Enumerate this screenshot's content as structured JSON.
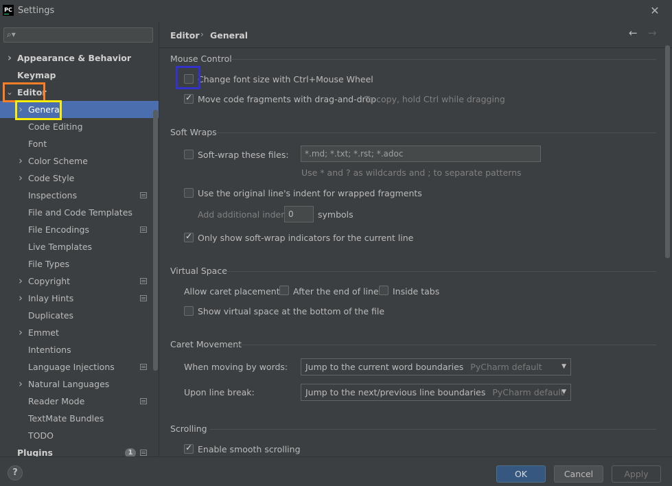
{
  "window": {
    "title": "Settings",
    "logo_text": "PC"
  },
  "search": {
    "placeholder": ""
  },
  "sidebar": {
    "items": [
      {
        "label": "Appearance & Behavior",
        "bold": true,
        "chevron": "right",
        "indent": 0
      },
      {
        "label": "Keymap",
        "bold": true,
        "chevron": "",
        "indent": 0
      },
      {
        "label": "Editor",
        "bold": true,
        "chevron": "down",
        "indent": 0
      },
      {
        "label": "General",
        "selected": true,
        "chevron": "right",
        "indent": 1
      },
      {
        "label": "Code Editing",
        "indent": 1
      },
      {
        "label": "Font",
        "indent": 1
      },
      {
        "label": "Color Scheme",
        "chevron": "right",
        "indent": 1
      },
      {
        "label": "Code Style",
        "chevron": "right",
        "indent": 1
      },
      {
        "label": "Inspections",
        "indent": 1,
        "badge": true
      },
      {
        "label": "File and Code Templates",
        "indent": 1
      },
      {
        "label": "File Encodings",
        "indent": 1,
        "badge": true
      },
      {
        "label": "Live Templates",
        "indent": 1
      },
      {
        "label": "File Types",
        "indent": 1
      },
      {
        "label": "Copyright",
        "chevron": "right",
        "indent": 1,
        "badge": true
      },
      {
        "label": "Inlay Hints",
        "chevron": "right",
        "indent": 1,
        "badge": true
      },
      {
        "label": "Duplicates",
        "indent": 1
      },
      {
        "label": "Emmet",
        "chevron": "right",
        "indent": 1
      },
      {
        "label": "Intentions",
        "indent": 1
      },
      {
        "label": "Language Injections",
        "indent": 1,
        "badge": true
      },
      {
        "label": "Natural Languages",
        "chevron": "right",
        "indent": 1
      },
      {
        "label": "Reader Mode",
        "indent": 1,
        "badge": true
      },
      {
        "label": "TextMate Bundles",
        "indent": 1
      },
      {
        "label": "TODO",
        "indent": 1
      },
      {
        "label": "Plugins",
        "bold": true,
        "indent": 0,
        "badge": true,
        "count": "1"
      }
    ]
  },
  "breadcrumb": {
    "parent": "Editor",
    "current": "General"
  },
  "mouse_control": {
    "title": "Mouse Control",
    "change_font": {
      "label": "Change font size with Ctrl+Mouse Wheel",
      "checked": false
    },
    "drag_drop": {
      "label": "Move code fragments with drag-and-drop",
      "checked": true,
      "hint": "To copy, hold Ctrl while dragging"
    }
  },
  "soft_wraps": {
    "title": "Soft Wraps",
    "softwrap_files": {
      "label": "Soft-wrap these files:",
      "checked": false,
      "value": "*.md; *.txt; *.rst; *.adoc",
      "hint": "Use * and ? as wildcards and ; to separate patterns"
    },
    "original_indent": {
      "label": "Use the original line's indent for wrapped fragments",
      "checked": false
    },
    "additional_indent": {
      "label": "Add additional indent:",
      "value": "0",
      "unit": "symbols"
    },
    "only_current": {
      "label": "Only show soft-wrap indicators for the current line",
      "checked": true
    }
  },
  "virtual_space": {
    "title": "Virtual Space",
    "caret_label": "Allow caret placement:",
    "after_end": {
      "label": "After the end of line",
      "checked": false
    },
    "inside_tabs": {
      "label": "Inside tabs",
      "checked": false
    },
    "show_virtual": {
      "label": "Show virtual space at the bottom of the file",
      "checked": false
    }
  },
  "caret_movement": {
    "title": "Caret Movement",
    "by_words": {
      "label": "When moving by words:",
      "value": "Jump to the current word boundaries",
      "default": "PyCharm default"
    },
    "line_break": {
      "label": "Upon line break:",
      "value": "Jump to the next/previous line boundaries",
      "default": "PyCharm default"
    }
  },
  "scrolling": {
    "title": "Scrolling",
    "smooth": {
      "label": "Enable smooth scrolling",
      "checked": true
    }
  },
  "footer": {
    "help": "?",
    "ok": "OK",
    "cancel": "Cancel",
    "apply": "Apply"
  },
  "colors": {
    "selection": "#4b6eaf",
    "highlight_editor": "#ff7f27",
    "highlight_general": "#ffee00",
    "highlight_checkbox": "#3333cc"
  }
}
